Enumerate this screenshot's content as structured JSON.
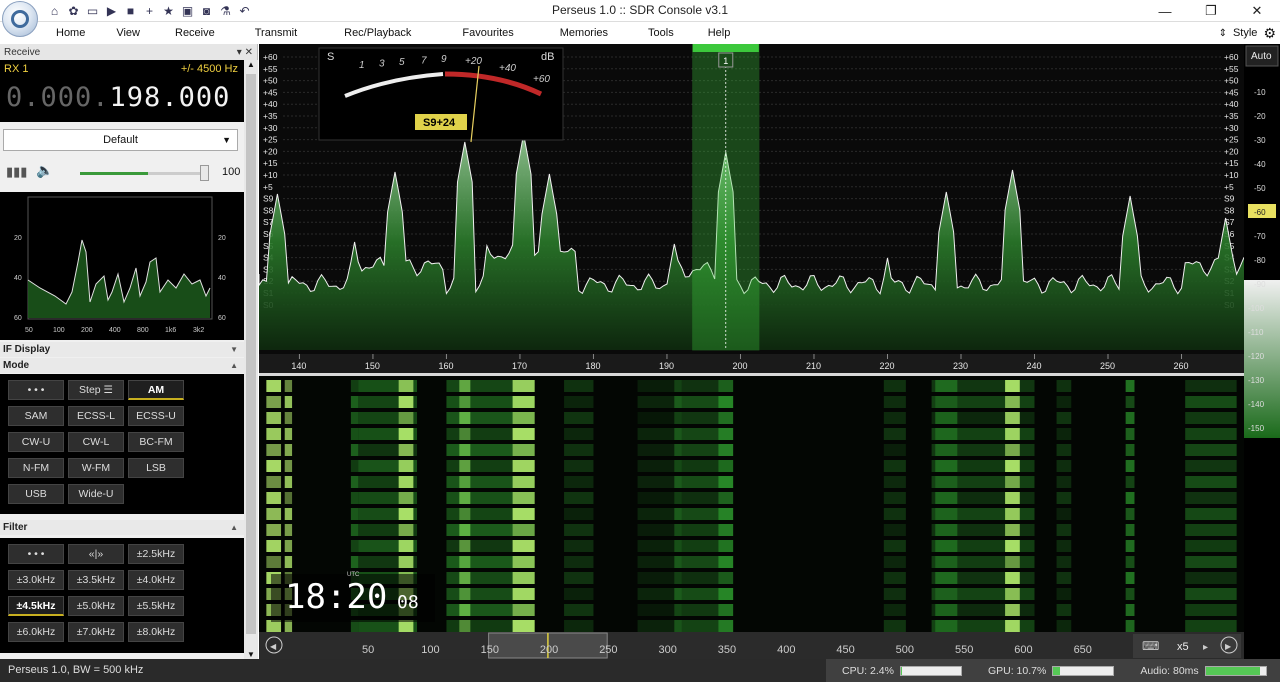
{
  "window": {
    "title": "Perseus 1.0 :: SDR Console v3.1"
  },
  "quick_access": [
    "home-icon",
    "settings-icon",
    "folder-icon",
    "play-icon",
    "stop-icon",
    "add-icon",
    "star-icon",
    "lock-icon",
    "camera-icon",
    "flask-icon",
    "undo-icon"
  ],
  "menu": {
    "items": [
      "Home",
      "View",
      "Receive",
      "Transmit",
      "Rec/Playback",
      "Favourites",
      "Memories",
      "Tools",
      "Help"
    ],
    "style_label": "Style"
  },
  "left": {
    "receive_title": "Receive",
    "rx_label": "RX 1",
    "bandwidth": "+/- 4500 Hz",
    "freq_dim": "0.000.",
    "freq_bright": "198.000",
    "preset": "Default",
    "volume": "100",
    "volume_fraction": 0.55,
    "if_display_label": "IF Display",
    "mode_label": "Mode",
    "filter_label": "Filter",
    "small_spec": {
      "x_ticks": [
        "50",
        "100",
        "200",
        "400",
        "800",
        "1k6",
        "3k2"
      ],
      "y_ticks": [
        "20",
        "40",
        "60"
      ]
    },
    "mode_buttons": [
      "• • •",
      "Step ☰",
      "AM",
      "SAM",
      "ECSS-L",
      "ECSS-U",
      "CW-U",
      "CW-L",
      "BC-FM",
      "N-FM",
      "W-FM",
      "LSB",
      "USB",
      "Wide-U"
    ],
    "mode_selected": "AM",
    "filter_buttons": [
      "• • •",
      "«|»",
      "±2.5kHz",
      "±3.0kHz",
      "±3.5kHz",
      "±4.0kHz",
      "±4.5kHz",
      "±5.0kHz",
      "±5.5kHz",
      "±6.0kHz",
      "±7.0kHz",
      "±8.0kHz"
    ],
    "filter_selected": "±4.5kHz"
  },
  "meter": {
    "s_label": "S",
    "db_label": "dB",
    "s_scale": [
      "1",
      "3",
      "5",
      "7",
      "9"
    ],
    "db_scale": [
      "+20",
      "+40",
      "+60"
    ],
    "reading": "S9+24"
  },
  "spectrum": {
    "left_scale": [
      "+60",
      "+55",
      "+50",
      "+45",
      "+40",
      "+35",
      "+30",
      "+25",
      "+20",
      "+15",
      "+10",
      "+5",
      "S9",
      "S8",
      "S7",
      "S6",
      "S5",
      "S4",
      "S3",
      "S2",
      "S1",
      "S0"
    ],
    "right_scale": [
      "+60",
      "+55",
      "+50",
      "+45",
      "+40",
      "+35",
      "+30",
      "+25",
      "+20",
      "+15",
      "+10",
      "+5",
      "S9",
      "S8",
      "S7",
      "S6",
      "S5",
      "S4",
      "S3",
      "S2",
      "S1",
      "S0"
    ],
    "freq_axis": [
      "140",
      "150",
      "160",
      "170",
      "180",
      "190",
      "200",
      "210",
      "220",
      "230",
      "240",
      "250",
      "260"
    ],
    "marker": "1",
    "axis_start_khz": 134.5,
    "axis_end_khz": 268.5,
    "filter_low_khz": 193.5,
    "filter_high_khz": 202.5,
    "marker_khz": 198
  },
  "waterfall": {
    "utc_label": "UTC",
    "time_main": "18:20",
    "time_sec": "08"
  },
  "overview": {
    "ticks": [
      "50",
      "100",
      "150",
      "200",
      "250",
      "300",
      "350",
      "400",
      "450",
      "500",
      "550",
      "600",
      "650"
    ],
    "zoom": "x5",
    "window_start_khz": 150,
    "window_end_khz": 250,
    "center_khz": 200
  },
  "right_scale": {
    "auto": "Auto",
    "ticks": [
      "-10",
      "-20",
      "-30",
      "-40",
      "-50",
      "-60",
      "-70",
      "-80",
      "-90",
      "-100",
      "-110",
      "-120",
      "-130",
      "-140",
      "-150"
    ],
    "highlight": "-60"
  },
  "status": {
    "left": "Perseus 1.0, BW = 500 kHz",
    "cpu": "CPU: 2.4%",
    "cpu_fraction": 0.024,
    "gpu": "GPU: 10.7%",
    "gpu_fraction": 0.107,
    "audio": "Audio: 80ms",
    "audio_fraction": 0.9
  },
  "colors": {
    "accent_green": "#3cc83c",
    "spectrum_bg": "#0a0a0a",
    "highlight_yellow": "#f0d040"
  }
}
